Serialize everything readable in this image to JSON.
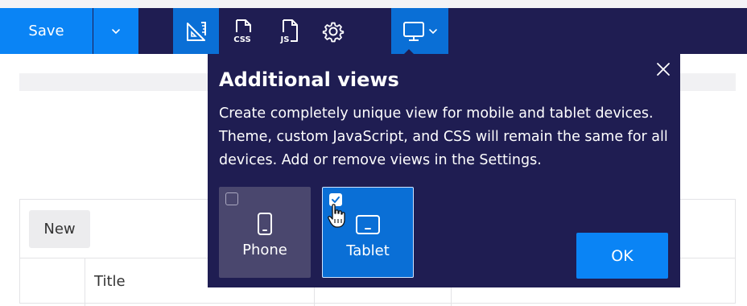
{
  "toolbar": {
    "save_label": "Save",
    "tools": [
      "layout-ruler-icon",
      "css-file-icon",
      "js-file-icon",
      "gear-icon",
      "desktop-device-icon"
    ]
  },
  "background": {
    "new_button_label": "New",
    "column_title": "Title"
  },
  "popup": {
    "title": "Additional views",
    "body": "Create completely unique view for mobile and tablet devices. Theme, custom JavaScript, and CSS will remain the same for all devices. Add or remove views in the Settings.",
    "options": [
      {
        "label": "Phone",
        "checked": false
      },
      {
        "label": "Tablet",
        "checked": true
      }
    ],
    "ok_label": "OK"
  },
  "colors": {
    "toolbar_bg": "#1f1d52",
    "accent": "#0a84f5",
    "active_tool": "#0a6fd6"
  }
}
